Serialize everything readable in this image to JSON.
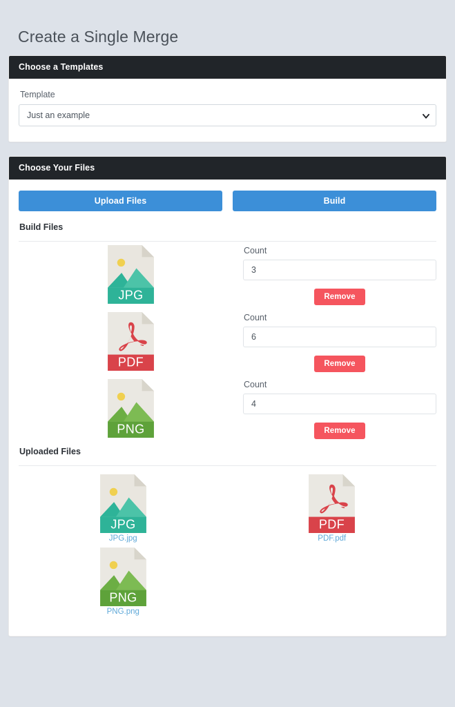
{
  "page": {
    "title": "Create a Single Merge",
    "background_color": "#dde2e9"
  },
  "colors": {
    "header_dark": "#212529",
    "primary_blue": "#3c8fd8",
    "danger_red": "#f5555e",
    "link_blue": "#5fa8d8",
    "jpg_accent": "#2eb398",
    "pdf_accent": "#d9434a",
    "png_accent": "#5ea23a"
  },
  "template_card": {
    "header": "Choose a Templates",
    "field_label": "Template",
    "select": {
      "selected": "Just an example",
      "options": [
        "Just an example"
      ],
      "caret_icon": "chevron-down-icon"
    }
  },
  "files_card": {
    "header": "Choose Your Files",
    "upload_button": "Upload Files",
    "build_button": "Build",
    "build_files_title": "Build Files",
    "uploaded_files_title": "Uploaded Files",
    "build_rows": [
      {
        "icon": "jpg-file-icon",
        "type": "JPG",
        "count_label": "Count",
        "count_value": "3",
        "remove_label": "Remove"
      },
      {
        "icon": "pdf-file-icon",
        "type": "PDF",
        "count_label": "Count",
        "count_value": "6",
        "remove_label": "Remove"
      },
      {
        "icon": "png-file-icon",
        "type": "PNG",
        "count_label": "Count",
        "count_value": "4",
        "remove_label": "Remove"
      }
    ],
    "uploaded_files": [
      {
        "icon": "jpg-file-icon",
        "type": "JPG",
        "name": "JPG.jpg"
      },
      {
        "icon": "pdf-file-icon",
        "type": "PDF",
        "name": "PDF.pdf"
      },
      {
        "icon": "png-file-icon",
        "type": "PNG",
        "name": "PNG.png"
      }
    ]
  }
}
